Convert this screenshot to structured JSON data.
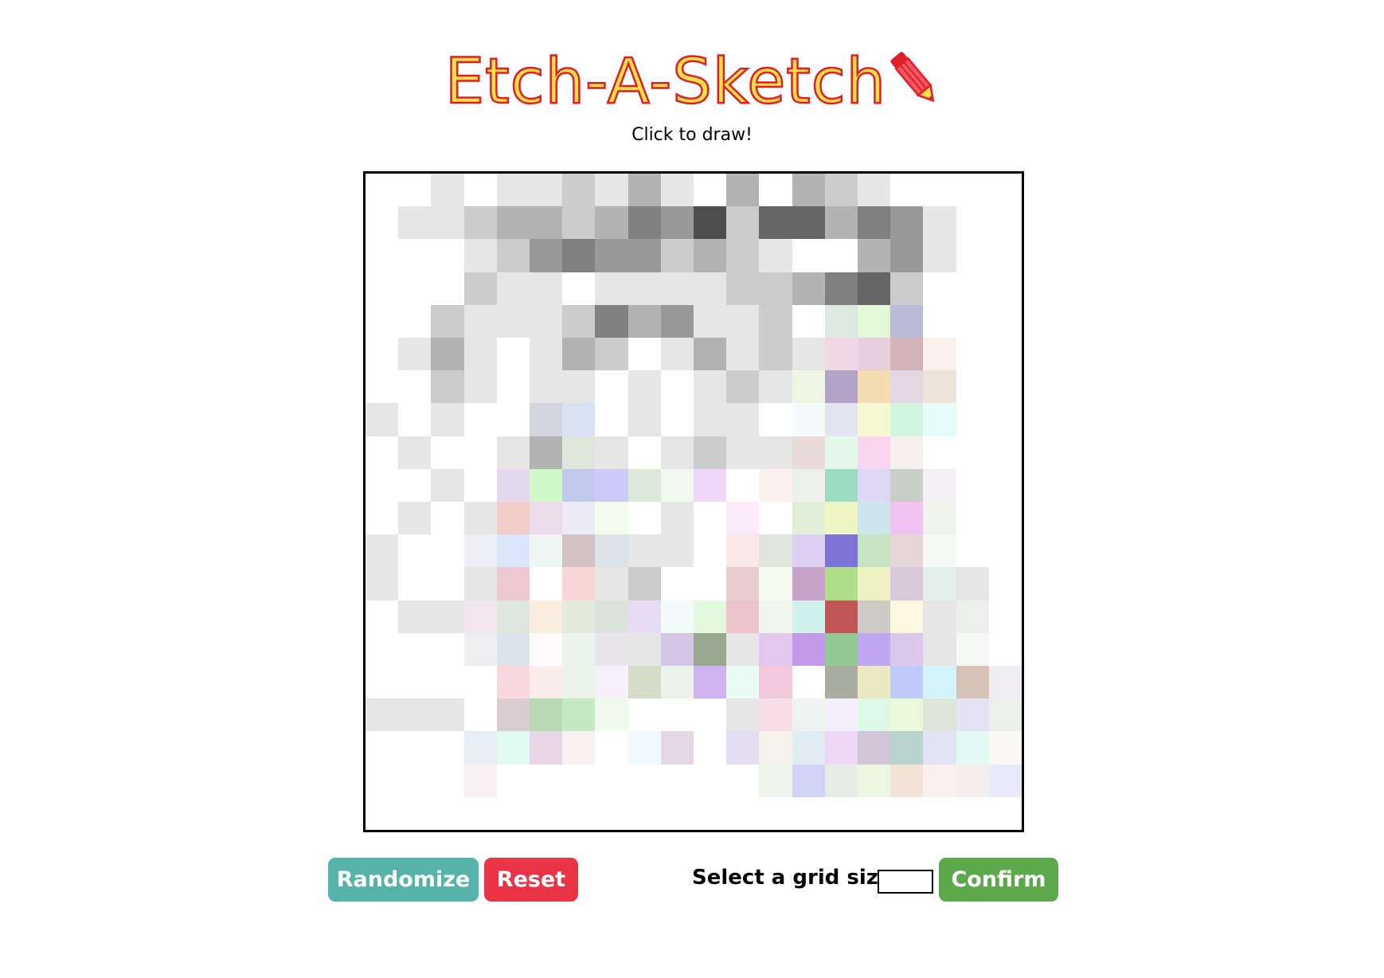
{
  "header": {
    "title": "Etch-A-Sketch",
    "subtitle": "Click to draw!"
  },
  "controls": {
    "randomize_label": "Randomize",
    "reset_label": "Reset",
    "grid_size_label": "Select a grid size:",
    "grid_size_value": "",
    "confirm_label": "Confirm"
  },
  "colors": {
    "title_fill": "#fde047",
    "title_outline": "#e11d2a",
    "randomize_bg": "#56b3aa",
    "reset_bg": "#ea3344",
    "confirm_bg": "#5ba94a",
    "canvas_border": "#000000"
  },
  "icons": {
    "title_icon": "pencil-icon"
  },
  "sketch": {
    "grid_size": 20,
    "cells": [
      [
        "#ffffff",
        "#ffffff",
        "#e6e6e6",
        "#ffffff",
        "#e6e6e6",
        "#e6e6e6",
        "#cccccc",
        "#e6e6e6",
        "#b3b3b3",
        "#e6e6e6",
        "#ffffff",
        "#b3b3b3",
        "#ffffff",
        "#b3b3b3",
        "#cccccc",
        "#e6e6e6",
        "#ffffff",
        "#ffffff",
        "#ffffff",
        "#ffffff"
      ],
      [
        "#ffffff",
        "#e6e6e6",
        "#e6e6e6",
        "#cccccc",
        "#b3b3b3",
        "#b3b3b3",
        "#cccccc",
        "#b3b3b3",
        "#808080",
        "#999999",
        "#4d4d4d",
        "#cccccc",
        "#666666",
        "#666666",
        "#b3b3b3",
        "#808080",
        "#999999",
        "#e6e6e6",
        "#ffffff",
        "#ffffff"
      ],
      [
        "#ffffff",
        "#ffffff",
        "#ffffff",
        "#e6e6e6",
        "#cccccc",
        "#999999",
        "#808080",
        "#999999",
        "#999999",
        "#cccccc",
        "#b3b3b3",
        "#cccccc",
        "#e6e6e6",
        "#ffffff",
        "#ffffff",
        "#b3b3b3",
        "#999999",
        "#e6e6e6",
        "#ffffff",
        "#ffffff"
      ],
      [
        "#ffffff",
        "#ffffff",
        "#ffffff",
        "#cccccc",
        "#e6e6e6",
        "#e6e6e6",
        "#ffffff",
        "#e6e6e6",
        "#e6e6e6",
        "#e6e6e6",
        "#e6e6e6",
        "#cccccc",
        "#cccccc",
        "#b3b3b3",
        "#808080",
        "#666666",
        "#cccccc",
        "#ffffff",
        "#ffffff",
        "#ffffff"
      ],
      [
        "#ffffff",
        "#ffffff",
        "#cccccc",
        "#e6e6e6",
        "#e6e6e6",
        "#e6e6e6",
        "#cccccc",
        "#808080",
        "#b3b3b3",
        "#999999",
        "#e6e6e6",
        "#e6e6e6",
        "#cccccc",
        "#ffffff",
        "#dde8e0",
        "#e3f8d8",
        "#babad6",
        "#ffffff",
        "#ffffff",
        "#ffffff"
      ],
      [
        "#ffffff",
        "#e6e6e6",
        "#b3b3b3",
        "#e6e6e6",
        "#ffffff",
        "#e6e6e6",
        "#b3b3b3",
        "#cccccc",
        "#ffffff",
        "#e6e6e6",
        "#b3b3b3",
        "#e6e6e6",
        "#cccccc",
        "#e6e6e6",
        "#f1d6e3",
        "#e6cfdc",
        "#d3b3b8",
        "#faf0ec",
        "#ffffff",
        "#ffffff"
      ],
      [
        "#ffffff",
        "#ffffff",
        "#cccccc",
        "#e6e6e6",
        "#ffffff",
        "#e6e6e6",
        "#e6e6e6",
        "#ffffff",
        "#e6e6e6",
        "#ffffff",
        "#e6e6e6",
        "#cccccc",
        "#e6e6e6",
        "#eef6e3",
        "#b3a3c8",
        "#f2dcb0",
        "#e5d6e2",
        "#ede3d8",
        "#ffffff",
        "#ffffff"
      ],
      [
        "#e6e6e6",
        "#ffffff",
        "#e6e6e6",
        "#ffffff",
        "#ffffff",
        "#d3d5de",
        "#d8e2f3",
        "#ffffff",
        "#e6e6e6",
        "#ffffff",
        "#e6e6e6",
        "#e6e6e6",
        "#ffffff",
        "#f5fafb",
        "#e3e3f2",
        "#f5f8d0",
        "#d3f5df",
        "#e5fbfc",
        "#ffffff",
        "#ffffff"
      ],
      [
        "#ffffff",
        "#e6e6e6",
        "#ffffff",
        "#ffffff",
        "#e6e6e6",
        "#b3b3b3",
        "#dde8da",
        "#e6e6e6",
        "#ffffff",
        "#e6e6e6",
        "#cccccc",
        "#e6e6e6",
        "#e6e6e6",
        "#eadbdb",
        "#e3f8e8",
        "#f8d6f0",
        "#f5f0ee",
        "#ffffff",
        "#ffffff",
        "#ffffff"
      ],
      [
        "#ffffff",
        "#ffffff",
        "#e6e6e6",
        "#ffffff",
        "#e8d8ef",
        "#d1f9c8",
        "#c0c8ec",
        "#cccbf7",
        "#dce8da",
        "#f0f8ef",
        "#eed8f7",
        "#ffffff",
        "#fbf0ee",
        "#eef0ec",
        "#9edbc3",
        "#ded8f5",
        "#c8d0c6",
        "#f2eff5",
        "#ffffff",
        "#ffffff"
      ],
      [
        "#ffffff",
        "#e6e6e6",
        "#ffffff",
        "#e6e6e6",
        "#f5cdc8",
        "#ecdcec",
        "#eceaf5",
        "#f2fcef",
        "#ffffff",
        "#e6e6e6",
        "#ffffff",
        "#fbeafa",
        "#ffffff",
        "#e2eed8",
        "#eef5c2",
        "#cde5ec",
        "#f2c2f2",
        "#eff3ec",
        "#ffffff",
        "#ffffff"
      ],
      [
        "#e6e6e6",
        "#ffffff",
        "#ffffff",
        "#eeeef8",
        "#dbe5fb",
        "#eef5f2",
        "#d3c3c6",
        "#dce3ea",
        "#e6e6e6",
        "#e6e6e6",
        "#ffffff",
        "#f8e8e6",
        "#e2e5dc",
        "#ded0f2",
        "#7b73d6",
        "#c8e3c3",
        "#e6d5d9",
        "#f6f8f5",
        "#ffffff",
        "#ffffff"
      ],
      [
        "#e6e6e6",
        "#ffffff",
        "#ffffff",
        "#e6e6e6",
        "#eec8d3",
        "#ffffff",
        "#f8d6d7",
        "#e6e6e6",
        "#cccccc",
        "#ffffff",
        "#ffffff",
        "#e8cccf",
        "#f5fbee",
        "#c8a3cc",
        "#b0de88",
        "#eef2c2",
        "#d8c8d8",
        "#e3f0ec",
        "#e6e6e6",
        "#ffffff"
      ],
      [
        "#ffffff",
        "#e6e6e6",
        "#e6e6e6",
        "#f3e6ee",
        "#dde6df",
        "#f9ede0",
        "#e3ecda",
        "#dce2dc",
        "#e8dcf5",
        "#f3fbfa",
        "#e3f8dc",
        "#edc3cc",
        "#f2f5ed",
        "#d0f2ec",
        "#c25556",
        "#cccbc6",
        "#fdf8e0",
        "#e6e6e6",
        "#ecefec",
        "#ffffff"
      ],
      [
        "#ffffff",
        "#ffffff",
        "#ffffff",
        "#efeef0",
        "#dbe3eb",
        "#fdfbfc",
        "#ecf3ed",
        "#e8e6ea",
        "#e6e6e6",
        "#d5c6e8",
        "#98a890",
        "#e6e6e6",
        "#e2c8ec",
        "#c29ae9",
        "#92c996",
        "#c0a6f0",
        "#dcc8ea",
        "#e6e6e6",
        "#f6f8f6",
        "#ffffff"
      ],
      [
        "#ffffff",
        "#ffffff",
        "#ffffff",
        "#ffffff",
        "#f8d8df",
        "#fbecec",
        "#ecf3ea",
        "#f6f0f8",
        "#d5dcca",
        "#edf3ec",
        "#ceb3f0",
        "#e8fbf5",
        "#f2c9dc",
        "#ffffff",
        "#aaaea0",
        "#ece8c3",
        "#c0caf8",
        "#d5f3fb",
        "#d8c3b8",
        "#f0eef3"
      ],
      [
        "#e6e6e6",
        "#e6e6e6",
        "#e6e6e6",
        "#ffffff",
        "#dbcdd1",
        "#b9d8b3",
        "#c6e9c3",
        "#effaed",
        "#ffffff",
        "#ffffff",
        "#ffffff",
        "#e6e6e6",
        "#f8dde6",
        "#ecf3f0",
        "#f3eefc",
        "#ddf8e6",
        "#e9f9dc",
        "#dde6d9",
        "#e5e3f3",
        "#ecefec"
      ],
      [
        "#ffffff",
        "#ffffff",
        "#ffffff",
        "#e9edf5",
        "#e2fbf2",
        "#e8d6e8",
        "#f8f2f2",
        "#ffffff",
        "#f0f8fb",
        "#e6d8e3",
        "#ffffff",
        "#e3def0",
        "#f5f3ec",
        "#e2ecf3",
        "#ecd8f5",
        "#d3c6d9",
        "#b8d3cc",
        "#e3e3f5",
        "#e2f8f5",
        "#faf8f5"
      ],
      [
        "#ffffff",
        "#ffffff",
        "#ffffff",
        "#f8f0f3",
        "#ffffff",
        "#ffffff",
        "#ffffff",
        "#ffffff",
        "#ffffff",
        "#ffffff",
        "#ffffff",
        "#ffffff",
        "#f0f5ec",
        "#d3d3f8",
        "#e8ece6",
        "#ecf8e3",
        "#f2e3d8",
        "#fbf0f0",
        "#f5eeee",
        "#eaeafa"
      ],
      [
        "#ffffff",
        "#ffffff",
        "#ffffff",
        "#ffffff",
        "#ffffff",
        "#ffffff",
        "#ffffff",
        "#ffffff",
        "#ffffff",
        "#ffffff",
        "#ffffff",
        "#ffffff",
        "#ffffff",
        "#ffffff",
        "#ffffff",
        "#ffffff",
        "#ffffff",
        "#ffffff",
        "#ffffff",
        "#ffffff"
      ]
    ]
  }
}
